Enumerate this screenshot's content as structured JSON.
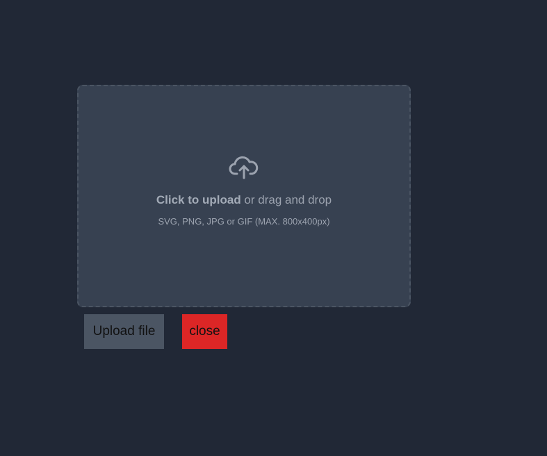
{
  "dropzone": {
    "icon": "cloud-upload-icon",
    "click_text": "Click to upload",
    "drag_text": " or drag and drop",
    "hint": "SVG, PNG, JPG or GIF (MAX. 800x400px)"
  },
  "actions": {
    "upload_label": "Upload file",
    "close_label": "close"
  },
  "colors": {
    "background": "#212836",
    "dropzone_bg": "#374151",
    "dropzone_border": "#4b5563",
    "upload_button": "#4b5563",
    "close_button": "#dc2626"
  }
}
